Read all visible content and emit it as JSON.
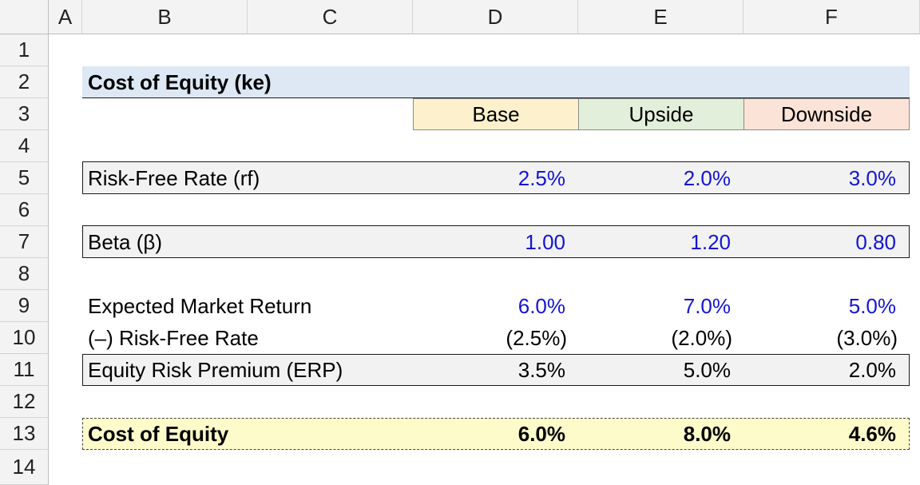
{
  "columns": [
    "A",
    "B",
    "C",
    "D",
    "E",
    "F"
  ],
  "rows": [
    "1",
    "2",
    "3",
    "4",
    "5",
    "6",
    "7",
    "8",
    "9",
    "10",
    "11",
    "12",
    "13",
    "14"
  ],
  "title": "Cost of Equity (ke)",
  "scenarios": [
    {
      "label": "Base",
      "color": "#fdf1cd"
    },
    {
      "label": "Upside",
      "color": "#e2efda"
    },
    {
      "label": "Downside",
      "color": "#fbe4d7"
    }
  ],
  "lines": {
    "rf": {
      "label": "Risk-Free Rate (rf)",
      "values": [
        "2.5%",
        "2.0%",
        "3.0%"
      ]
    },
    "beta": {
      "label": "Beta (β)",
      "values": [
        "1.00",
        "1.20",
        "0.80"
      ]
    },
    "emr": {
      "label": "Expected Market Return",
      "values": [
        "6.0%",
        "7.0%",
        "5.0%"
      ]
    },
    "less_rf": {
      "label": "(–) Risk-Free Rate",
      "values": [
        "(2.5%)",
        "(2.0%)",
        "(3.0%)"
      ]
    },
    "erp": {
      "label": "Equity Risk Premium (ERP)",
      "values": [
        "3.5%",
        "5.0%",
        "2.0%"
      ]
    },
    "coe": {
      "label": "Cost of Equity",
      "values": [
        "6.0%",
        "8.0%",
        "4.6%"
      ]
    }
  },
  "colors": {
    "input_blue": "#1414d6",
    "title_band": "#dde8f4",
    "highlight_yellow": "#fdfbc9"
  }
}
